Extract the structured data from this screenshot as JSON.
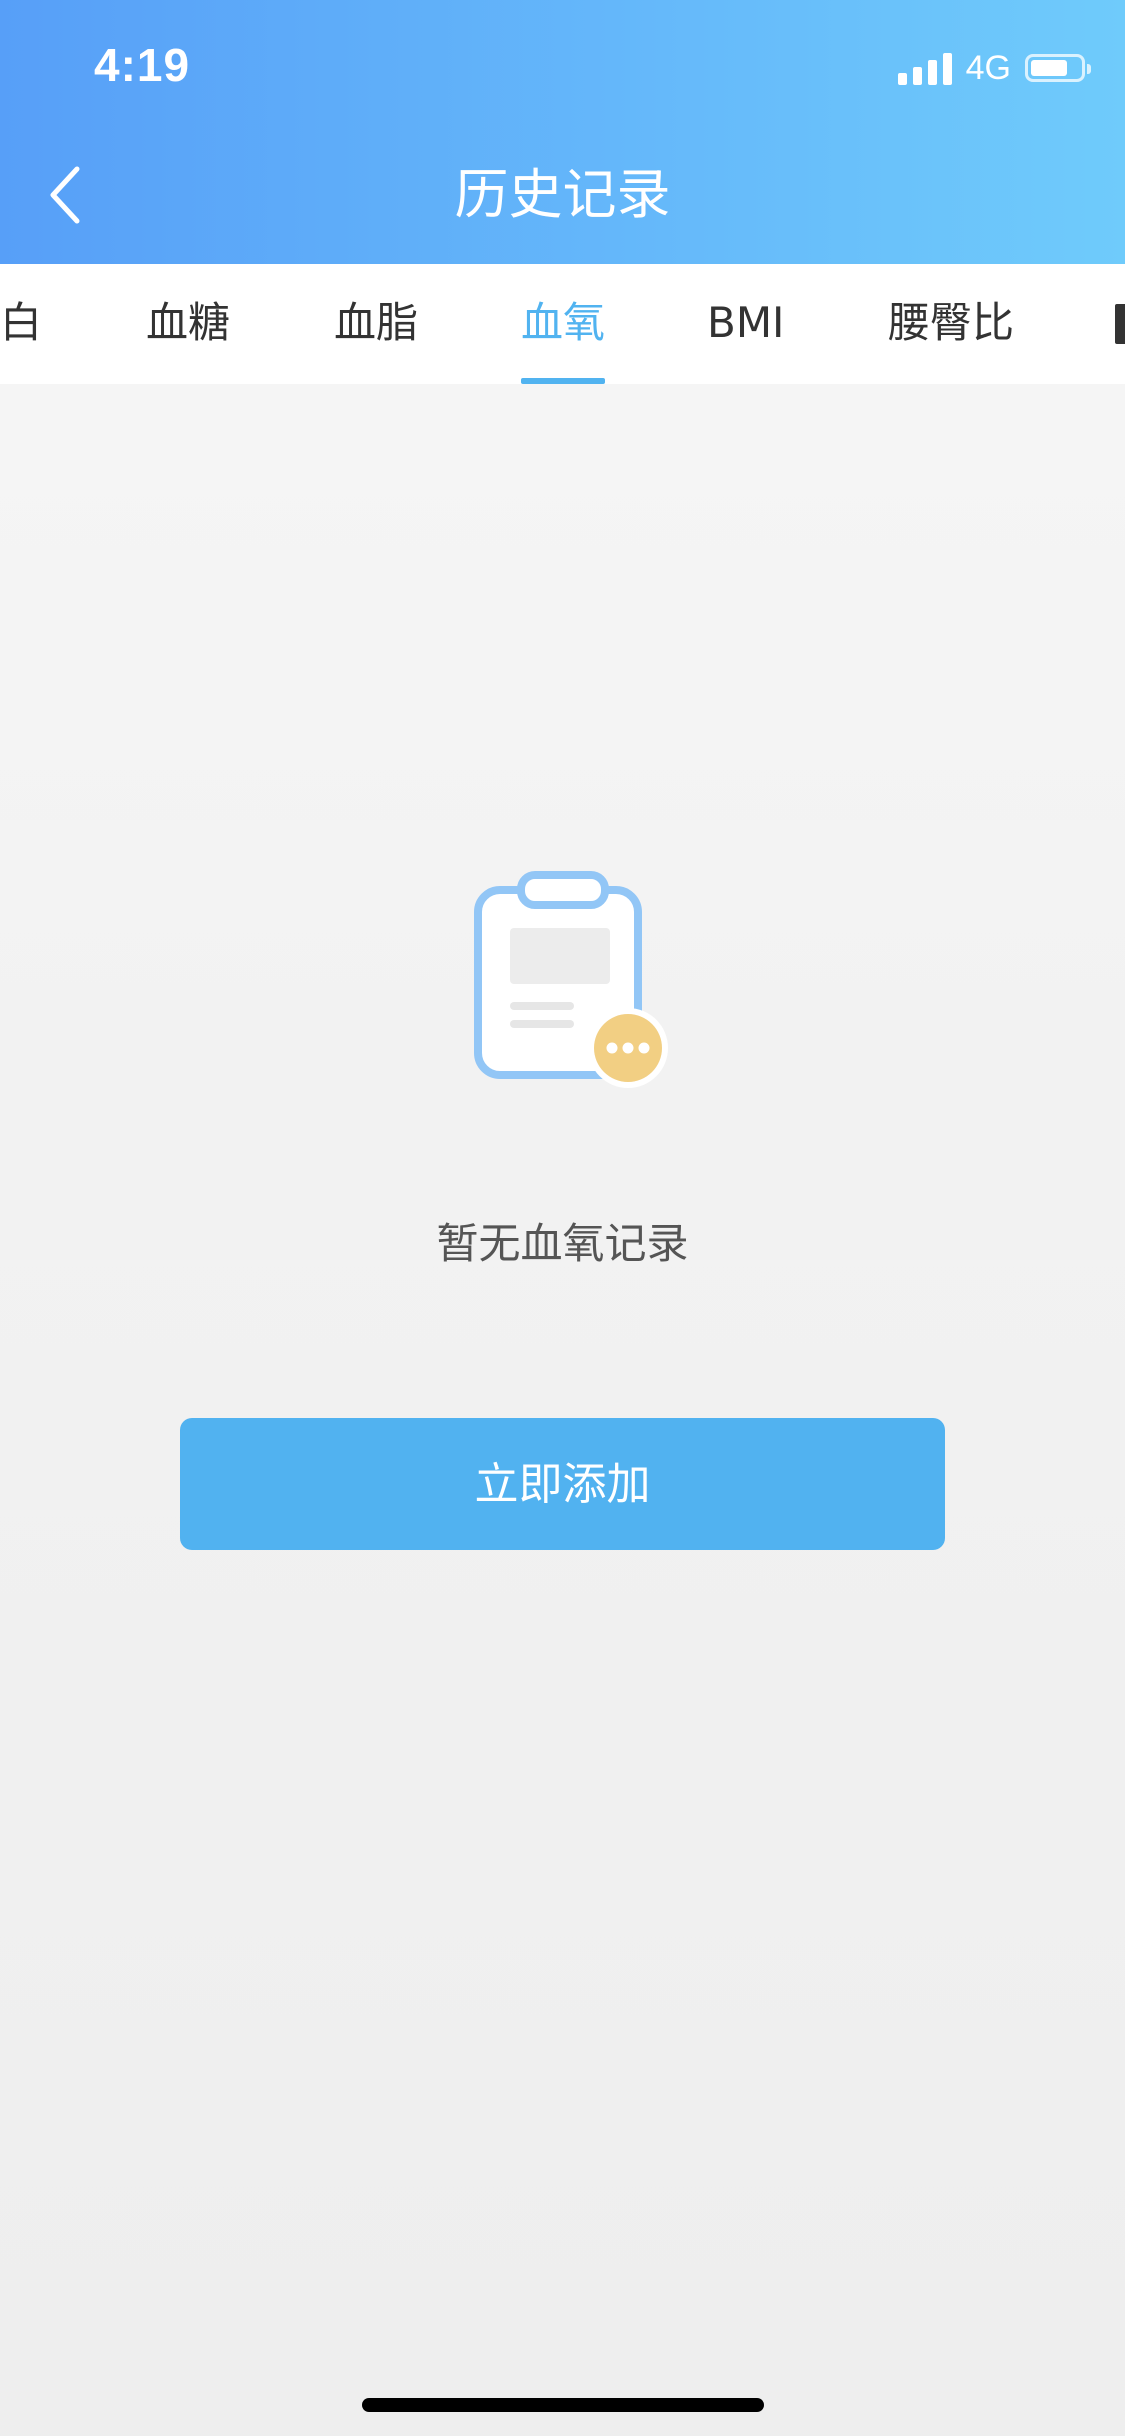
{
  "status_bar": {
    "time": "4:19",
    "network": "4G"
  },
  "header": {
    "title": "历史记录"
  },
  "tabs": [
    {
      "label": "白",
      "active": false
    },
    {
      "label": "血糖",
      "active": false
    },
    {
      "label": "血脂",
      "active": false
    },
    {
      "label": "血氧",
      "active": true
    },
    {
      "label": "BMI",
      "active": false
    },
    {
      "label": "腰臀比",
      "active": false
    }
  ],
  "empty_state": {
    "message": "暂无血氧记录",
    "action_label": "立即添加",
    "icon": "clipboard-icon"
  },
  "colors": {
    "accent": "#51b3f0",
    "header_start": "#579ff8",
    "header_end": "#6fcbfb",
    "badge": "#f2cf83"
  }
}
